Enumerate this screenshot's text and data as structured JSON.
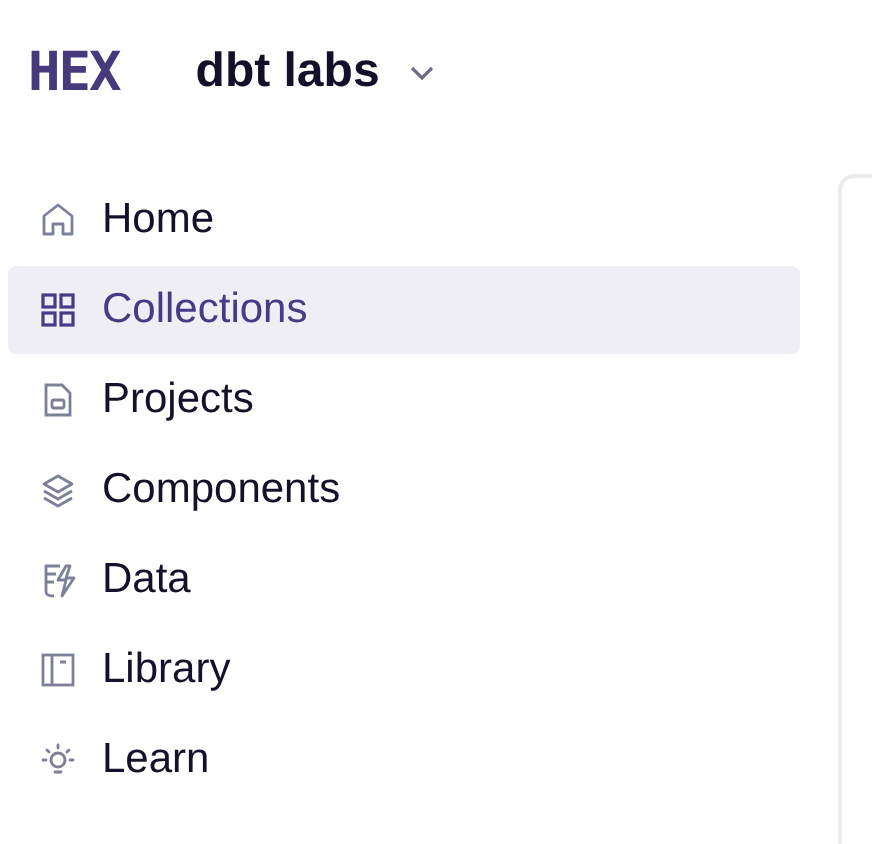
{
  "logo": "HEX",
  "workspace": {
    "name": "dbt labs"
  },
  "nav": [
    {
      "label": "Home",
      "selected": false
    },
    {
      "label": "Collections",
      "selected": true
    },
    {
      "label": "Projects",
      "selected": false
    },
    {
      "label": "Components",
      "selected": false
    },
    {
      "label": "Data",
      "selected": false
    },
    {
      "label": "Library",
      "selected": false
    },
    {
      "label": "Learn",
      "selected": false
    }
  ]
}
